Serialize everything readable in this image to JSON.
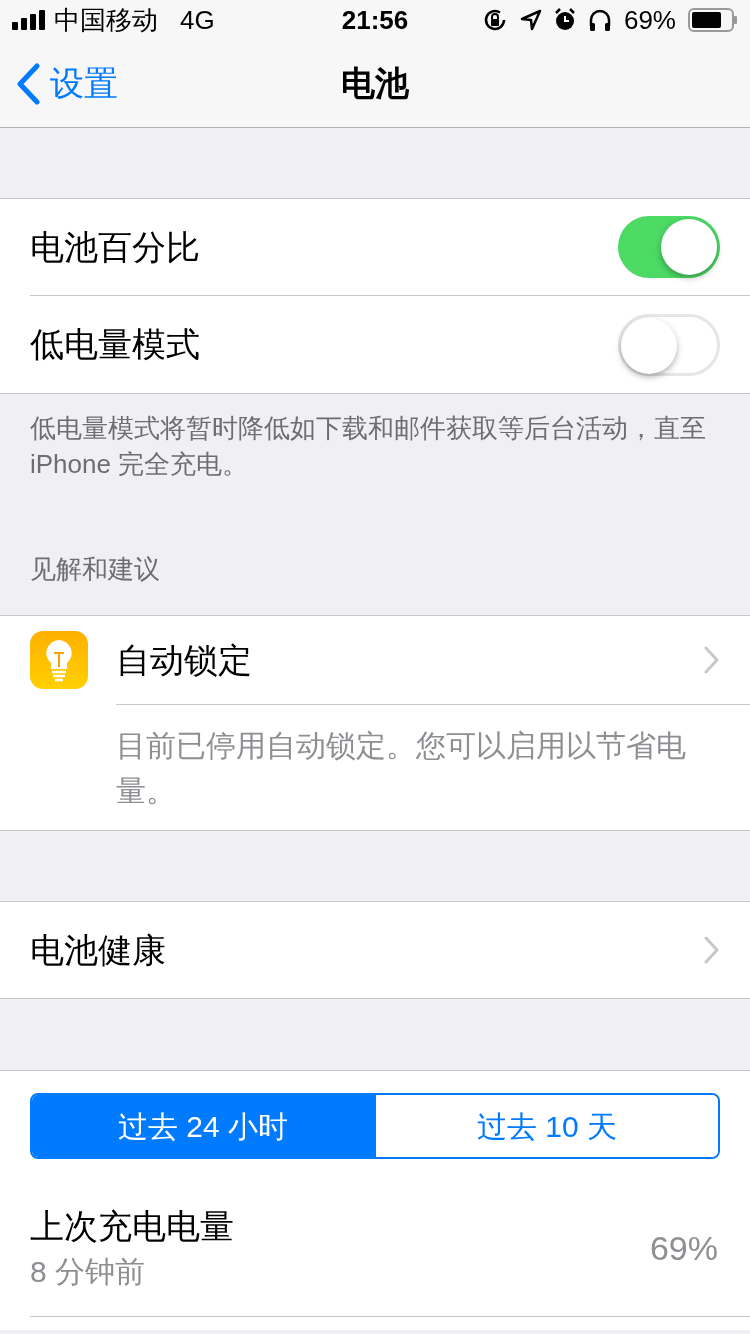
{
  "status_bar": {
    "carrier": "中国移动",
    "network": "4G",
    "time": "21:56",
    "battery": "69%"
  },
  "nav": {
    "back": "设置",
    "title": "电池"
  },
  "toggles": [
    {
      "label": "电池百分比",
      "on": true
    },
    {
      "label": "低电量模式",
      "on": false
    }
  ],
  "toggle_footer": "低电量模式将暂时降低如下载和邮件获取等后台活动，直至iPhone 完全充电。",
  "insights": {
    "header": "见解和建议",
    "title": "自动锁定",
    "description": "目前已停用自动锁定。您可以启用以节省电量。"
  },
  "health": {
    "label": "电池健康"
  },
  "segments": [
    {
      "label": "过去 24 小时",
      "selected": true
    },
    {
      "label": "过去 10 天",
      "selected": false
    }
  ],
  "last_charge": {
    "title": "上次充电电量",
    "time": "8 分钟前",
    "value": "69%"
  }
}
